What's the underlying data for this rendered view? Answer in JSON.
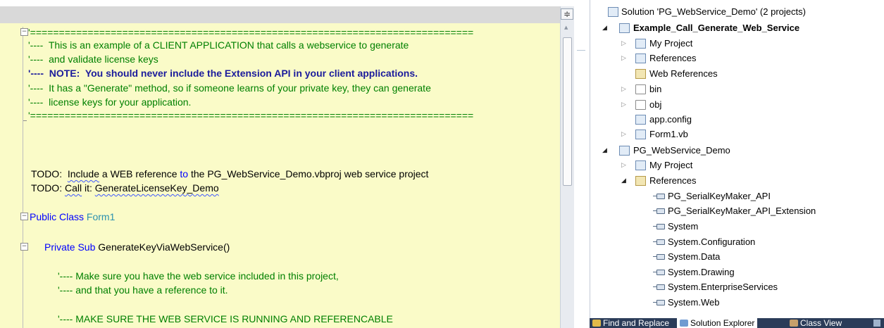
{
  "editor": {
    "split_glyph": "≑",
    "scroll_up_glyph": "▲",
    "lines": {
      "rule_top": "'=============================================================================",
      "c1": "'----  This is an example of a CLIENT APPLICATION that calls a webservice to generate",
      "c2": "'----  and validate license keys",
      "c3": "'----  NOTE:  You should never include the Extension API in your client applications.",
      "c4": "'----  It has a \"Generate\" method, so if someone learns of your private key, they can generate",
      "c5": "'----  license keys for your application.",
      "rule_bottom": "'============================================================================="
    },
    "todo1": {
      "prefix": "TODO:  ",
      "word": "Include",
      "mid": " a WEB reference ",
      "kw": "to",
      "rest": " the PG_WebService_Demo.vbproj web service project"
    },
    "todo2": {
      "prefix": "TODO: ",
      "word": "Call",
      "mid": " it: ",
      "name": "GenerateLicenseKey_Demo"
    },
    "class_line": {
      "kw": "Public Class",
      "name": "Form1"
    },
    "sub_line": {
      "kw": "Private Sub",
      "name": "GenerateKeyViaWebService()"
    },
    "body": {
      "b1": "'---- Make sure you have the web service included in this project,",
      "b2": "'---- and that you have a reference to it.",
      "b3": "'---- MAKE SURE THE WEB SERVICE IS RUNNING AND REFERENCABLE"
    },
    "fold_minus": "−"
  },
  "explorer": {
    "solution": "Solution 'PG_WebService_Demo' (2 projects)",
    "project1": "Example_Call_Generate_Web_Service",
    "p1_items": [
      "My Project",
      "References",
      "Web References",
      "bin",
      "obj",
      "app.config",
      "Form1.vb"
    ],
    "project2": "PG_WebService_Demo",
    "p2_items": [
      "My Project",
      "References"
    ],
    "references": [
      "PG_SerialKeyMaker_API",
      "PG_SerialKeyMaker_API_Extension",
      "System",
      "System.Configuration",
      "System.Data",
      "System.Drawing",
      "System.EnterpriseServices",
      "System.Web"
    ],
    "expand_open": "◢",
    "expand_closed": "▷"
  },
  "tabs": [
    "Find and Replace",
    "Solution Explorer",
    "Class View"
  ],
  "colors": {
    "code_background": "#fafbc8",
    "comment": "#008000",
    "keyword": "#0000ff",
    "type_name": "#2b91af",
    "note": "#1b1b9c",
    "tabstrip": "#2b3c59"
  }
}
